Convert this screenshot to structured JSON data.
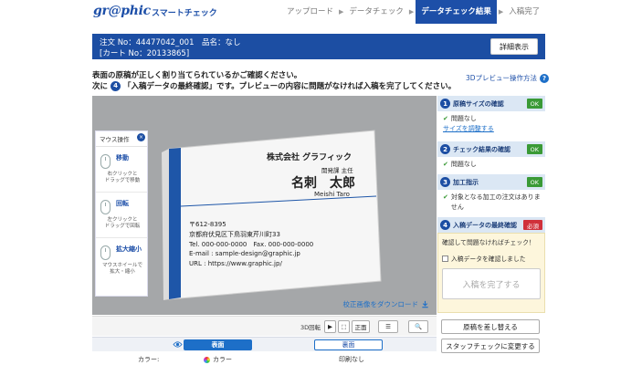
{
  "header": {
    "logo": "gr@phic",
    "logo_sub": "スマートチェック",
    "steps": [
      {
        "label": "アップロード",
        "active": false
      },
      {
        "label": "データチェック",
        "active": false
      },
      {
        "label": "データチェック結果",
        "active": true
      },
      {
        "label": "入稿完了",
        "active": false
      }
    ]
  },
  "order": {
    "line1": "注文 No：44477042_001　品名：なし",
    "line2": "[カート No：20133865]",
    "detail_button": "詳細表示"
  },
  "instructions": {
    "line1": "表面の原稿が正しく割り当てられているかご確認ください。",
    "line2_prefix": "次に",
    "line2_num": "4",
    "line2_body": "「入稿データの最終確認」です。プレビューの内容に問題がなければ入稿を完了してください。",
    "preview_help": "3Dプレビュー操作方法",
    "help_glyph": "?"
  },
  "mouse_panel": {
    "title": "マウス操作",
    "close_glyph": "×",
    "items": [
      {
        "name": "移動",
        "desc": "右クリックと\nドラッグで移動"
      },
      {
        "name": "回転",
        "desc": "左クリックと\nドラッグで回転"
      },
      {
        "name": "拡大縮小",
        "desc": "マウスホイールで\n拡大・縮小"
      }
    ]
  },
  "card": {
    "company": "株式会社 グラフィック",
    "dept": "開発課 主任",
    "name": "名刺　太郎",
    "romaji": "Meishi Taro",
    "zip": "〒612-8395",
    "address": "京都府伏見区下鳥羽東芹川町33",
    "tel": "Tel. 000-000-0000　Fax. 000-000-0000",
    "email": "E-mail : sample-design@graphic.jp",
    "url": "URL : https://www.graphic.jp/"
  },
  "download_link": "校正画像をダウンロード",
  "toolbar": {
    "label_3d": "3D回転",
    "play": "▶",
    "b2": "⬚",
    "front": "正面",
    "layout": "☰",
    "zoom": "🔍"
  },
  "face": {
    "front_label": "表面",
    "back_label": "裏面",
    "color_label": "カラー:",
    "front_color": "カラー",
    "back_color": "印刷なし"
  },
  "checks": [
    {
      "num": "1",
      "title": "原稿サイズの確認",
      "badge": "OK",
      "badge_type": "ok",
      "result": "問題なし",
      "link": "サイズを調整する"
    },
    {
      "num": "2",
      "title": "チェック結果の確認",
      "badge": "OK",
      "badge_type": "ok",
      "result": "問題なし"
    },
    {
      "num": "3",
      "title": "加工指示",
      "badge": "OK",
      "badge_type": "ok",
      "result": "対象となる加工の注文はありません"
    },
    {
      "num": "4",
      "title": "入稿データの最終確認",
      "badge": "必須",
      "badge_type": "need"
    }
  ],
  "final": {
    "prompt": "確認して問題なければチェック！",
    "checkbox_label": "入稿データを確認しました",
    "complete_button": "入稿を完了する"
  },
  "side_buttons": {
    "replace": "原稿を差し替える",
    "staff": "スタッフチェックに変更する"
  },
  "check_glyph": "✔"
}
